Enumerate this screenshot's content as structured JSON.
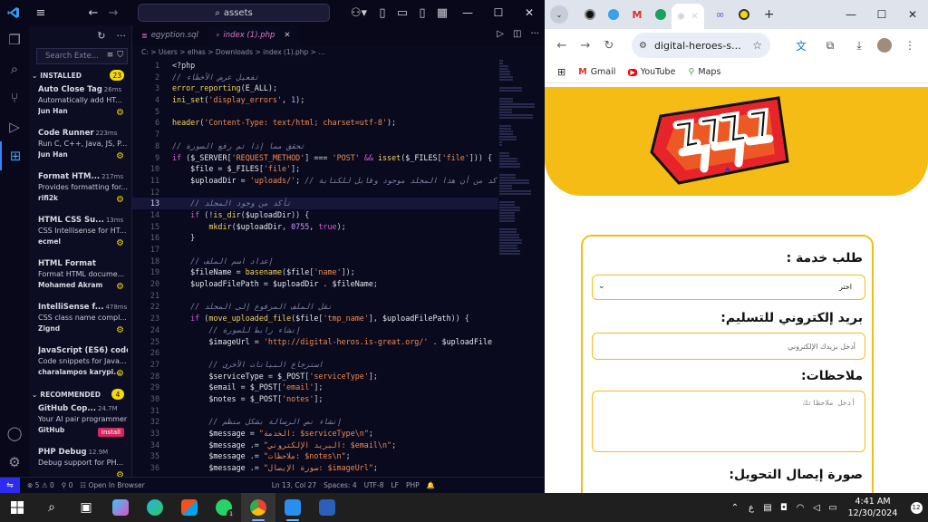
{
  "vscode": {
    "search_title": "assets",
    "sidebar": {
      "search_placeholder": "Search Exte...",
      "installed_label": "INSTALLED",
      "installed_count": "23",
      "recommended_label": "RECOMMENDED",
      "recommended_count": "4",
      "installed": [
        {
          "name": "Auto Close Tag",
          "meta": "26ms",
          "desc": "Automatically add HT...",
          "author": "Jun Han"
        },
        {
          "name": "Code Runner",
          "meta": "223ms",
          "desc": "Run C, C++, Java, JS, P...",
          "author": "Jun Han"
        },
        {
          "name": "Format HTM...",
          "meta": "217ms",
          "desc": "Provides formatting for...",
          "author": "rifi2k"
        },
        {
          "name": "HTML CSS Su...",
          "meta": "13ms",
          "desc": "CSS Intellisense for HT...",
          "author": "ecmel"
        },
        {
          "name": "HTML Format",
          "meta": "",
          "desc": "Format HTML docume...",
          "author": "Mohamed Akram"
        },
        {
          "name": "IntelliSense f...",
          "meta": "478ms",
          "desc": "CSS class name compl...",
          "author": "Zignd"
        },
        {
          "name": "JavaScript (ES6) code...",
          "meta": "",
          "desc": "Code snippets for Java...",
          "author": "charalampos karypi..."
        }
      ],
      "recommended": [
        {
          "name": "GitHub Cop...",
          "meta": "24.7M",
          "desc": "Your AI pair programmer",
          "author": "GitHub",
          "action": "Install"
        },
        {
          "name": "PHP Debug",
          "meta": "12.9M",
          "desc": "Debug support for PH...",
          "author": ""
        }
      ]
    },
    "tabs": [
      {
        "label": "egyption.sql",
        "active": false
      },
      {
        "label": "index (1).php",
        "active": true
      }
    ],
    "breadcrumb": "C: > Users > elhas > Downloads > index (1).php > ...",
    "current_line": 13,
    "code_lines": [
      {
        "n": "1",
        "html": "<span class=\"c-op\">&lt;?php</span>"
      },
      {
        "n": "2",
        "html": "<span class=\"c-com\">// تفعيل عرض الأخطاء</span>"
      },
      {
        "n": "3",
        "html": "<span class=\"c-fn\">error_reporting</span><span class=\"c-op\">(</span><span class=\"c-var\">E_ALL</span><span class=\"c-op\">);</span>"
      },
      {
        "n": "4",
        "html": "<span class=\"c-fn\">ini_set</span><span class=\"c-op\">(</span><span class=\"c-str\">'display_errors'</span><span class=\"c-op\">, </span><span class=\"c-num\">1</span><span class=\"c-op\">);</span>"
      },
      {
        "n": "5",
        "html": ""
      },
      {
        "n": "6",
        "html": "<span class=\"c-fn\">header</span><span class=\"c-op\">(</span><span class=\"c-str\">'Content-Type: text/html; charset=utf-8'</span><span class=\"c-op\">);</span>"
      },
      {
        "n": "7",
        "html": ""
      },
      {
        "n": "8",
        "html": "<span class=\"c-com\">// تحقق مما إذا تم رفع الصورة</span>"
      },
      {
        "n": "9",
        "html": "<span class=\"c-kw\">if</span><span class=\"c-op\"> (</span><span class=\"c-var\">$_SERVER</span><span class=\"c-op\">[</span><span class=\"c-str\">'REQUEST_METHOD'</span><span class=\"c-op\">] === </span><span class=\"c-str\">'POST'</span><span class=\"c-kw\"> &amp;&amp; </span><span class=\"c-fn\">isset</span><span class=\"c-op\">(</span><span class=\"c-var\">$_FILES</span><span class=\"c-op\">[</span><span class=\"c-str\">'file'</span><span class=\"c-op\">])) {</span>"
      },
      {
        "n": "10",
        "html": "    <span class=\"c-var\">$file</span><span class=\"c-op\"> = </span><span class=\"c-var\">$_FILES</span><span class=\"c-op\">[</span><span class=\"c-str\">'file'</span><span class=\"c-op\">];</span>"
      },
      {
        "n": "11",
        "html": "    <span class=\"c-var\">$uploadDir</span><span class=\"c-op\"> = </span><span class=\"c-str\">'uploads/'</span><span class=\"c-op\">; </span><span class=\"c-com\">// تأكد من أن هذا المجلد موجود وقابل للكتابة</span>"
      },
      {
        "n": "12",
        "html": ""
      },
      {
        "n": "13",
        "html": "    <span class=\"c-com\">// تأكد من وجود المجلد</span>"
      },
      {
        "n": "14",
        "html": "    <span class=\"c-kw\">if</span><span class=\"c-op\"> (!</span><span class=\"c-fn\">is_dir</span><span class=\"c-op\">(</span><span class=\"c-var\">$uploadDir</span><span class=\"c-op\">)) {</span>"
      },
      {
        "n": "15",
        "html": "        <span class=\"c-fn\">mkdir</span><span class=\"c-op\">(</span><span class=\"c-var\">$uploadDir</span><span class=\"c-op\">, </span><span class=\"c-num\">0755</span><span class=\"c-op\">, </span><span class=\"c-kw\">true</span><span class=\"c-op\">);</span>"
      },
      {
        "n": "16",
        "html": "    <span class=\"c-op\">}</span>"
      },
      {
        "n": "17",
        "html": ""
      },
      {
        "n": "18",
        "html": "    <span class=\"c-com\">// إعداد اسم الملف</span>"
      },
      {
        "n": "19",
        "html": "    <span class=\"c-var\">$fileName</span><span class=\"c-op\"> = </span><span class=\"c-fn\">basename</span><span class=\"c-op\">(</span><span class=\"c-var\">$file</span><span class=\"c-op\">[</span><span class=\"c-str\">'name'</span><span class=\"c-op\">]);</span>"
      },
      {
        "n": "20",
        "html": "    <span class=\"c-var\">$uploadFilePath</span><span class=\"c-op\"> = </span><span class=\"c-var\">$uploadDir</span><span class=\"c-op\"> . </span><span class=\"c-var\">$fileName</span><span class=\"c-op\">;</span>"
      },
      {
        "n": "21",
        "html": ""
      },
      {
        "n": "22",
        "html": "    <span class=\"c-com\">// نقل الملف المرفوع إلى المجلد</span>"
      },
      {
        "n": "23",
        "html": "    <span class=\"c-kw\">if</span><span class=\"c-op\"> (</span><span class=\"c-fn\">move_uploaded_file</span><span class=\"c-op\">(</span><span class=\"c-var\">$file</span><span class=\"c-op\">[</span><span class=\"c-str\">'tmp_name'</span><span class=\"c-op\">], </span><span class=\"c-var\">$uploadFilePath</span><span class=\"c-op\">)) {</span>"
      },
      {
        "n": "24",
        "html": "        <span class=\"c-com\">// إنشاء رابط للصورة</span>"
      },
      {
        "n": "25",
        "html": "        <span class=\"c-var\">$imageUrl</span><span class=\"c-op\"> = </span><span class=\"c-str\">'http://digital-heros.is-great.org/'</span><span class=\"c-op\"> . </span><span class=\"c-var\">$uploadFile</span>"
      },
      {
        "n": "26",
        "html": ""
      },
      {
        "n": "27",
        "html": "        <span class=\"c-com\">// استرجاع البيانات الأخرى</span>"
      },
      {
        "n": "28",
        "html": "        <span class=\"c-var\">$serviceType</span><span class=\"c-op\"> = </span><span class=\"c-var\">$_POST</span><span class=\"c-op\">[</span><span class=\"c-str\">'serviceType'</span><span class=\"c-op\">];</span>"
      },
      {
        "n": "29",
        "html": "        <span class=\"c-var\">$email</span><span class=\"c-op\"> = </span><span class=\"c-var\">$_POST</span><span class=\"c-op\">[</span><span class=\"c-str\">'email'</span><span class=\"c-op\">];</span>"
      },
      {
        "n": "30",
        "html": "        <span class=\"c-var\">$notes</span><span class=\"c-op\"> = </span><span class=\"c-var\">$_POST</span><span class=\"c-op\">[</span><span class=\"c-str\">'notes'</span><span class=\"c-op\">];</span>"
      },
      {
        "n": "31",
        "html": ""
      },
      {
        "n": "32",
        "html": "        <span class=\"c-com\">// إنشاء نص الرسالة بشكل منظم</span>"
      },
      {
        "n": "33",
        "html": "        <span class=\"c-var\">$message</span><span class=\"c-op\"> = </span><span class=\"c-str\">\"الخدمة: $serviceType\\n\"</span><span class=\"c-op\">;</span>"
      },
      {
        "n": "34",
        "html": "        <span class=\"c-var\">$message</span><span class=\"c-op\"> .= </span><span class=\"c-str\">\"البريد الإلكتروني: $email\\n\"</span><span class=\"c-op\">;</span>"
      },
      {
        "n": "35",
        "html": "        <span class=\"c-var\">$message</span><span class=\"c-op\"> .= </span><span class=\"c-str\">\"ملاحظات: $notes\\n\"</span><span class=\"c-op\">;</span>"
      },
      {
        "n": "36",
        "html": "        <span class=\"c-var\">$message</span><span class=\"c-op\"> .= </span><span class=\"c-str\">\"صورة الإيصال: $imageUrl\"</span><span class=\"c-op\">;</span>"
      }
    ],
    "status": {
      "errors": "5",
      "warnings": "0",
      "ports": "0",
      "open_in_browser": "Open In Browser",
      "position": "Ln 13, Col 27",
      "spaces": "Spaces: 4",
      "encoding": "UTF-8",
      "eol": "LF",
      "language": "PHP"
    }
  },
  "chrome": {
    "url": "digital-heroes-s...",
    "bookmarks": [
      {
        "label": "Gmail",
        "icon": "gmail-icon"
      },
      {
        "label": "YouTube",
        "icon": "youtube-icon"
      },
      {
        "label": "Maps",
        "icon": "maps-icon"
      }
    ],
    "form": {
      "service_label": "طلب خدمة :",
      "service_value": "اختر",
      "email_label": "بريد إلكتروني للتسليم:",
      "email_placeholder": "أدخل بريدك الإلكتروني",
      "notes_label": "ملاحظات:",
      "notes_placeholder": "أدخل ملاحظاتك",
      "receipt_label": "صورة إيصال التحويل:"
    }
  },
  "taskbar": {
    "time": "4:41 AM",
    "date": "12/30/2024",
    "lang": "ع",
    "notifications": "12",
    "whatsapp_badge": "1"
  },
  "colors": {
    "accent_yellow": "#f5bc16",
    "vscode_bg": "#0a0a1f",
    "gear_yellow": "#f5d90a",
    "install_pink": "#d7265e"
  }
}
